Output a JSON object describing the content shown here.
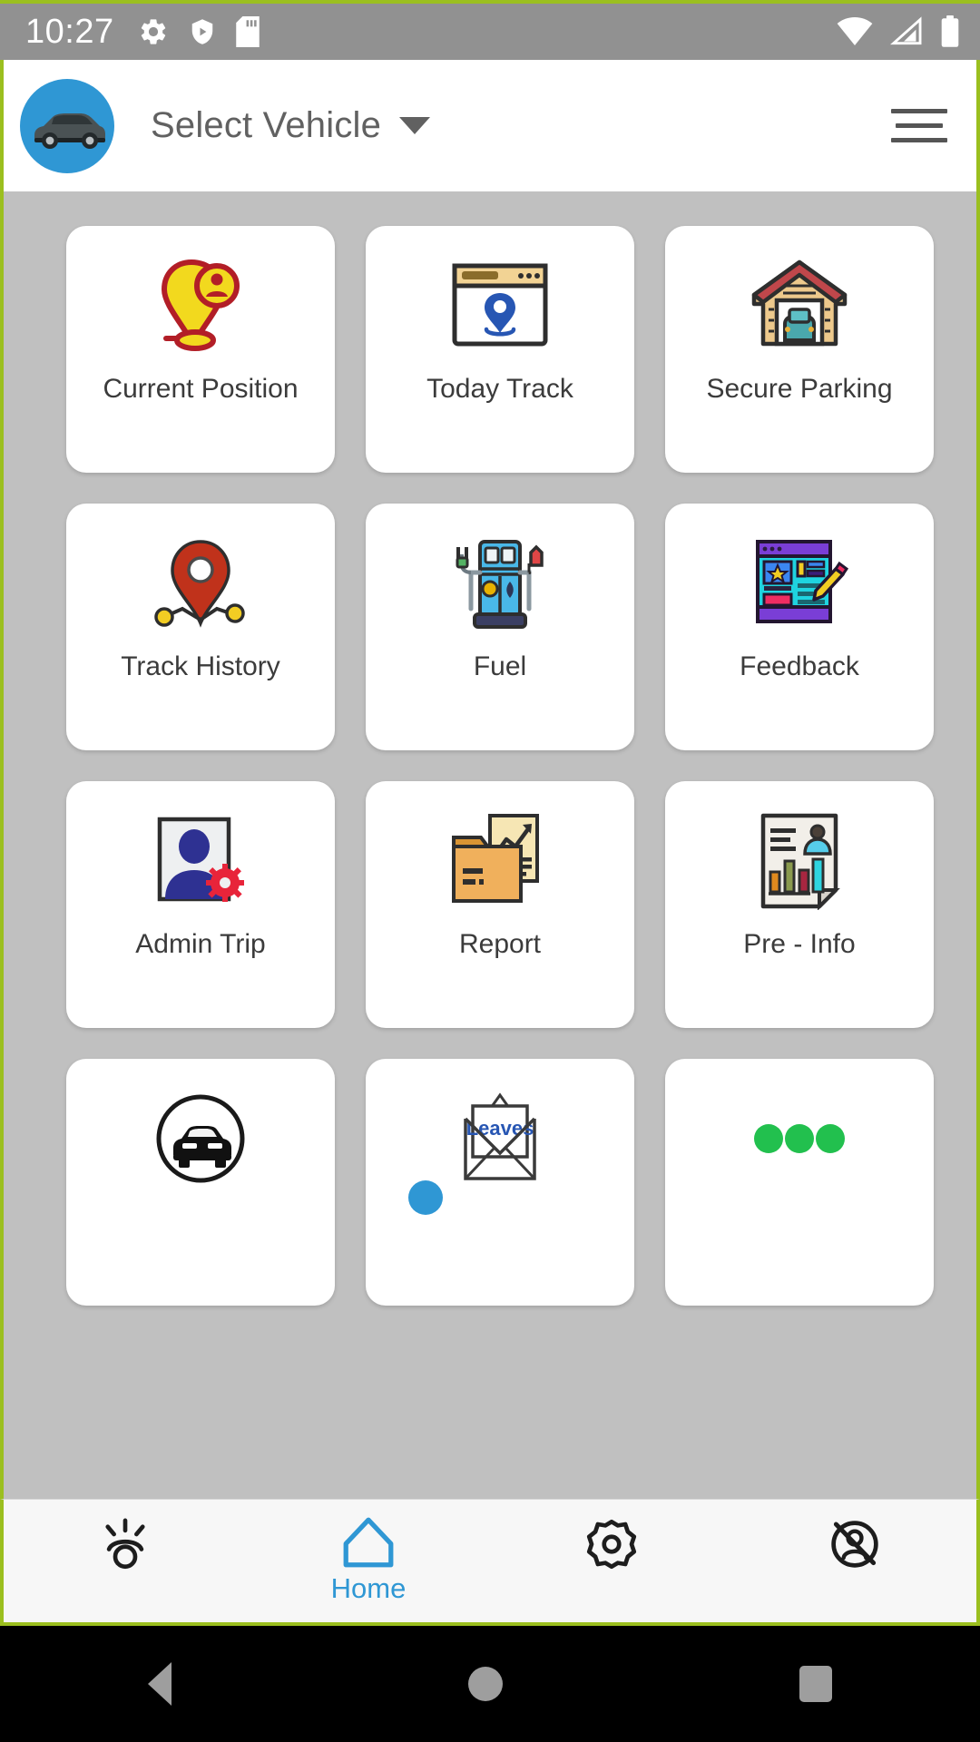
{
  "theme": {
    "frame_green": "#9bbf1f",
    "statusbar_bg": "#919191",
    "content_bg": "#c0c0c0",
    "accent_blue": "#2f97d4",
    "tile_bg": "#ffffff",
    "label_color": "#3b3b3b"
  },
  "statusbar": {
    "time": "10:27",
    "left_icons": [
      "gear-icon",
      "play-protect-shield-icon",
      "sd-card-icon"
    ],
    "right_icons": [
      "wifi-icon",
      "cellular-signal-icon",
      "battery-icon"
    ]
  },
  "appbar": {
    "avatar_icon": "vehicle-avatar-icon",
    "title": "Select Vehicle",
    "dropdown_icon": "chevron-down-icon",
    "menu_icon": "hamburger-menu-icon"
  },
  "grid": {
    "tiles": [
      {
        "label": "Current Position",
        "icon": "location-pin-person-icon"
      },
      {
        "label": "Today Track",
        "icon": "browser-window-pin-icon"
      },
      {
        "label": "Secure Parking",
        "icon": "garage-car-icon"
      },
      {
        "label": "Track History",
        "icon": "route-pin-icon"
      },
      {
        "label": "Fuel",
        "icon": "fuel-pump-icon"
      },
      {
        "label": "Feedback",
        "icon": "review-form-pencil-icon"
      },
      {
        "label": "Admin Trip",
        "icon": "user-gear-icon"
      },
      {
        "label": "Report",
        "icon": "folder-chart-icon"
      },
      {
        "label": "Pre - Info",
        "icon": "document-chart-person-icon"
      },
      {
        "label": "",
        "icon": "car-in-circle-icon"
      },
      {
        "label": "",
        "icon": "leaves-envelope-icon"
      },
      {
        "label": "",
        "icon": "three-green-dots-icon"
      }
    ],
    "leaves_text": "Leaves"
  },
  "pager": {
    "total": 3,
    "active_index": 0
  },
  "bottomnav": {
    "items": [
      {
        "label": "",
        "icon": "brightness-lamp-icon",
        "active": false
      },
      {
        "label": "Home",
        "icon": "home-icon",
        "active": true
      },
      {
        "label": "",
        "icon": "gear-icon",
        "active": false
      },
      {
        "label": "",
        "icon": "user-logout-icon",
        "active": false
      }
    ]
  },
  "androidnav": {
    "back_label": "back-button",
    "home_label": "home-button",
    "recents_label": "recents-button"
  }
}
